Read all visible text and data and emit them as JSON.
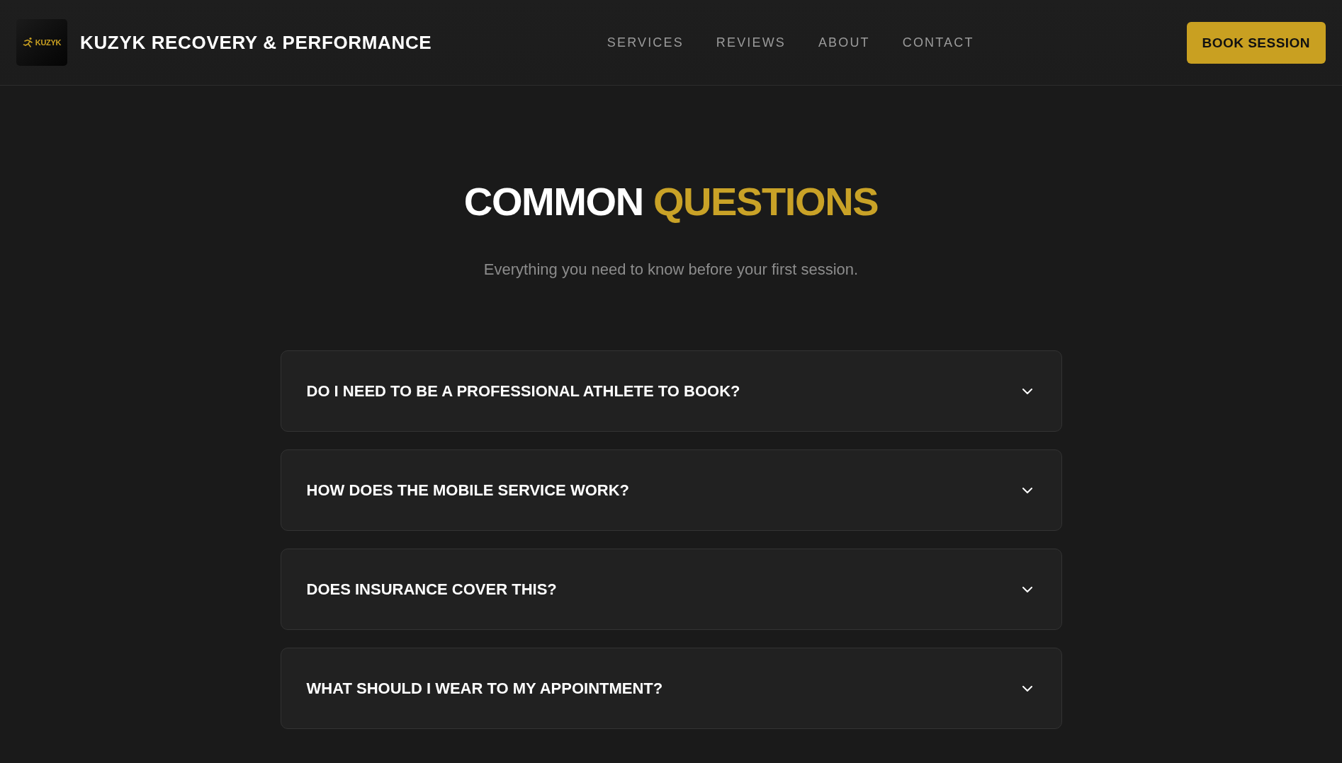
{
  "header": {
    "logo": {
      "text": "KUZYK"
    },
    "brand": "KUZYK RECOVERY & PERFORMANCE",
    "nav": [
      {
        "label": "SERVICES"
      },
      {
        "label": "REVIEWS"
      },
      {
        "label": "ABOUT"
      },
      {
        "label": "CONTACT"
      }
    ],
    "cta": "BOOK SESSION"
  },
  "faq": {
    "title": "COMMON",
    "title_highlight": "QUESTIONS",
    "subtitle": "Everything you need to know before your first session.",
    "items": [
      {
        "question": "DO I NEED TO BE A PROFESSIONAL ATHLETE TO BOOK?",
        "expanded": false
      },
      {
        "question": "HOW DOES THE MOBILE SERVICE WORK?",
        "expanded": false
      },
      {
        "question": "DOES INSURANCE COVER THIS?",
        "expanded": false
      },
      {
        "question": "WHAT SHOULD I WEAR TO MY APPOINTMENT?",
        "expanded": false
      }
    ]
  }
}
